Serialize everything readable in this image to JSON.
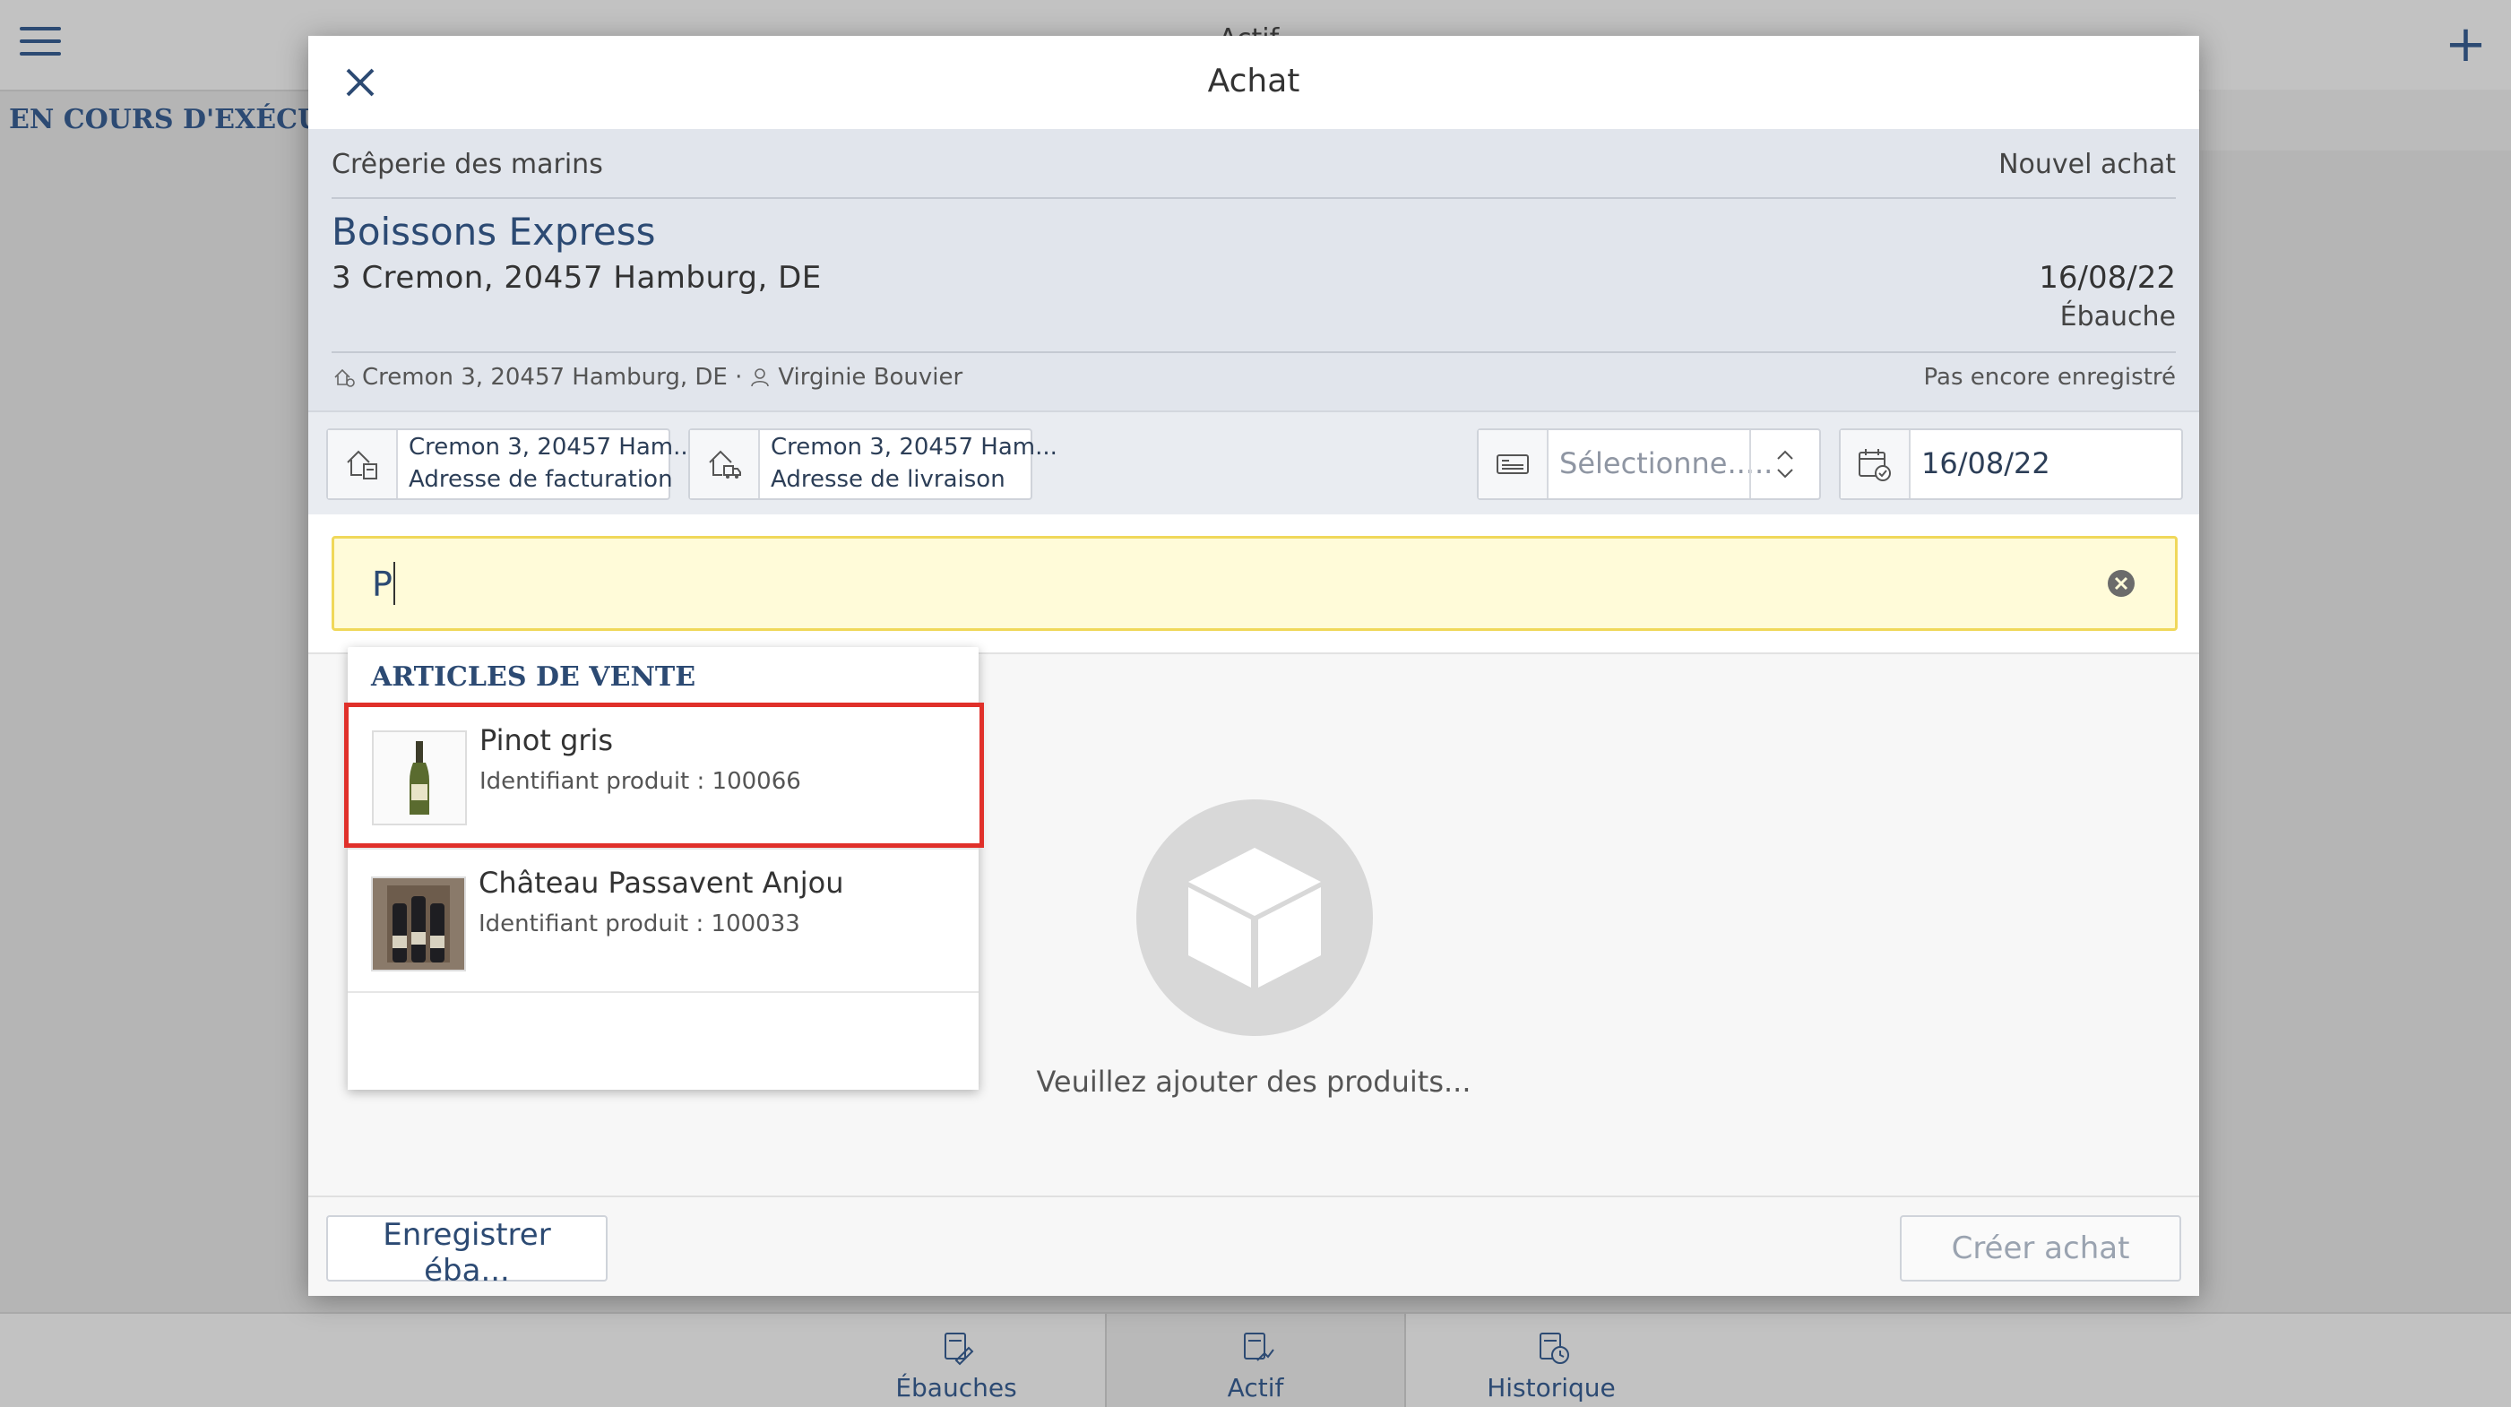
{
  "app": {
    "title": "Actif",
    "section_label": "EN COURS D'EXÉCUTION",
    "tabs": [
      {
        "label": "Ébauches",
        "icon": "drafts-icon"
      },
      {
        "label": "Actif",
        "icon": "active-icon"
      },
      {
        "label": "Historique",
        "icon": "history-icon"
      }
    ]
  },
  "modal": {
    "title": "Achat",
    "company": "Crêperie des marins",
    "purchase_type": "Nouvel achat",
    "supplier_name": "Boissons Express",
    "supplier_address": "3 Cremon, 20457 Hamburg, DE",
    "date": "16/08/22",
    "status": "Ébauche",
    "meta_address": "Cremon 3, 20457 Hamburg, DE ·",
    "meta_contact": "Virginie Bouvier",
    "save_status": "Pas encore enregistré"
  },
  "fields": {
    "billing": {
      "value": "Cremon 3, 20457 Ham...",
      "label": "Adresse de facturation"
    },
    "delivery": {
      "value": "Cremon 3, 20457 Ham...",
      "label": "Adresse de livraison"
    },
    "payment_select": {
      "placeholder": "Sélectionne....."
    },
    "date_field": {
      "value": "16/08/22"
    }
  },
  "search": {
    "value": "P"
  },
  "dropdown": {
    "header": "ARTICLES DE VENTE",
    "items": [
      {
        "name": "Pinot gris",
        "id_label": "Identifiant produit : 100066"
      },
      {
        "name": "Château Passavent Anjou",
        "id_label": "Identifiant produit : 100033"
      }
    ]
  },
  "empty_state": {
    "text": "Veuillez ajouter des produits..."
  },
  "footer": {
    "save_draft": "Enregistrer éba...",
    "create": "Créer achat"
  }
}
